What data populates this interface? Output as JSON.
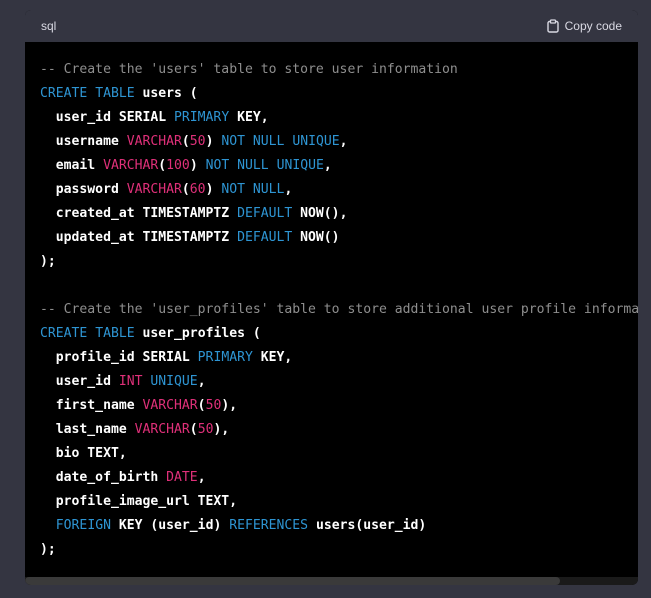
{
  "header": {
    "language": "sql",
    "copy_label": "Copy code"
  },
  "colors": {
    "comment": "#8e8e8e",
    "keyword": "#2e95d3",
    "type": "#df3079",
    "text": "#ffffff",
    "header_bg": "#343541",
    "code_bg": "#000000"
  },
  "icons": {
    "copy": "clipboard-icon"
  },
  "code_lines": [
    [
      {
        "t": "c",
        "v": "-- Create the 'users' table to store user information"
      }
    ],
    [
      {
        "t": "k",
        "v": "CREATE"
      },
      {
        "t": "p",
        "v": " "
      },
      {
        "t": "k",
        "v": "TABLE"
      },
      {
        "t": "p",
        "v": " users ("
      }
    ],
    [
      {
        "t": "p",
        "v": "  user_id SERIAL "
      },
      {
        "t": "k",
        "v": "PRIMARY"
      },
      {
        "t": "p",
        "v": " KEY,"
      }
    ],
    [
      {
        "t": "p",
        "v": "  username "
      },
      {
        "t": "y",
        "v": "VARCHAR"
      },
      {
        "t": "p",
        "v": "("
      },
      {
        "t": "n",
        "v": "50"
      },
      {
        "t": "p",
        "v": ") "
      },
      {
        "t": "k",
        "v": "NOT"
      },
      {
        "t": "p",
        "v": " "
      },
      {
        "t": "k",
        "v": "NULL"
      },
      {
        "t": "p",
        "v": " "
      },
      {
        "t": "k",
        "v": "UNIQUE"
      },
      {
        "t": "p",
        "v": ","
      }
    ],
    [
      {
        "t": "p",
        "v": "  email "
      },
      {
        "t": "y",
        "v": "VARCHAR"
      },
      {
        "t": "p",
        "v": "("
      },
      {
        "t": "n",
        "v": "100"
      },
      {
        "t": "p",
        "v": ") "
      },
      {
        "t": "k",
        "v": "NOT"
      },
      {
        "t": "p",
        "v": " "
      },
      {
        "t": "k",
        "v": "NULL"
      },
      {
        "t": "p",
        "v": " "
      },
      {
        "t": "k",
        "v": "UNIQUE"
      },
      {
        "t": "p",
        "v": ","
      }
    ],
    [
      {
        "t": "p",
        "v": "  password "
      },
      {
        "t": "y",
        "v": "VARCHAR"
      },
      {
        "t": "p",
        "v": "("
      },
      {
        "t": "n",
        "v": "60"
      },
      {
        "t": "p",
        "v": ") "
      },
      {
        "t": "k",
        "v": "NOT"
      },
      {
        "t": "p",
        "v": " "
      },
      {
        "t": "k",
        "v": "NULL"
      },
      {
        "t": "p",
        "v": ","
      }
    ],
    [
      {
        "t": "p",
        "v": "  created_at TIMESTAMPTZ "
      },
      {
        "t": "k",
        "v": "DEFAULT"
      },
      {
        "t": "p",
        "v": " NOW(),"
      }
    ],
    [
      {
        "t": "p",
        "v": "  updated_at TIMESTAMPTZ "
      },
      {
        "t": "k",
        "v": "DEFAULT"
      },
      {
        "t": "p",
        "v": " NOW()"
      }
    ],
    [
      {
        "t": "p",
        "v": ");"
      }
    ],
    [
      {
        "t": "p",
        "v": ""
      }
    ],
    [
      {
        "t": "c",
        "v": "-- Create the 'user_profiles' table to store additional user profile information"
      }
    ],
    [
      {
        "t": "k",
        "v": "CREATE"
      },
      {
        "t": "p",
        "v": " "
      },
      {
        "t": "k",
        "v": "TABLE"
      },
      {
        "t": "p",
        "v": " user_profiles ("
      }
    ],
    [
      {
        "t": "p",
        "v": "  profile_id SERIAL "
      },
      {
        "t": "k",
        "v": "PRIMARY"
      },
      {
        "t": "p",
        "v": " KEY,"
      }
    ],
    [
      {
        "t": "p",
        "v": "  user_id "
      },
      {
        "t": "y",
        "v": "INT"
      },
      {
        "t": "p",
        "v": " "
      },
      {
        "t": "k",
        "v": "UNIQUE"
      },
      {
        "t": "p",
        "v": ","
      }
    ],
    [
      {
        "t": "p",
        "v": "  first_name "
      },
      {
        "t": "y",
        "v": "VARCHAR"
      },
      {
        "t": "p",
        "v": "("
      },
      {
        "t": "n",
        "v": "50"
      },
      {
        "t": "p",
        "v": "),"
      }
    ],
    [
      {
        "t": "p",
        "v": "  last_name "
      },
      {
        "t": "y",
        "v": "VARCHAR"
      },
      {
        "t": "p",
        "v": "("
      },
      {
        "t": "n",
        "v": "50"
      },
      {
        "t": "p",
        "v": "),"
      }
    ],
    [
      {
        "t": "p",
        "v": "  bio TEXT,"
      }
    ],
    [
      {
        "t": "p",
        "v": "  date_of_birth "
      },
      {
        "t": "y",
        "v": "DATE"
      },
      {
        "t": "p",
        "v": ","
      }
    ],
    [
      {
        "t": "p",
        "v": "  profile_image_url TEXT,"
      }
    ],
    [
      {
        "t": "p",
        "v": "  "
      },
      {
        "t": "k",
        "v": "FOREIGN"
      },
      {
        "t": "p",
        "v": " KEY (user_id) "
      },
      {
        "t": "k",
        "v": "REFERENCES"
      },
      {
        "t": "p",
        "v": " users(user_id)"
      }
    ],
    [
      {
        "t": "p",
        "v": ");"
      }
    ]
  ]
}
